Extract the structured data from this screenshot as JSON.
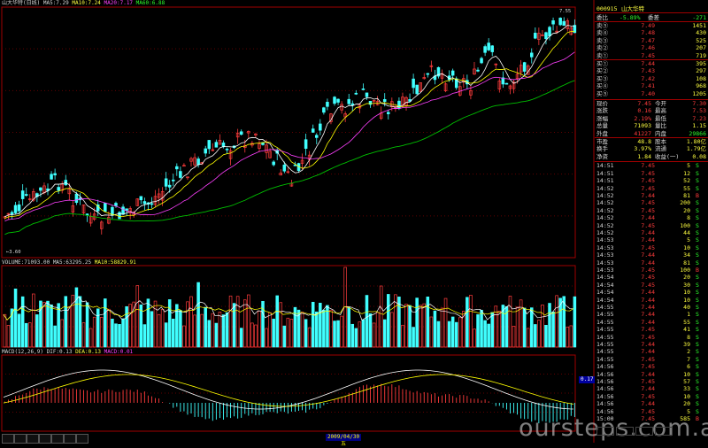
{
  "main_panel": {
    "title": "山大华特(日线)",
    "ma5": "MA5:7.29",
    "ma10": "MA10:7.24",
    "ma20": "MA20:7.17",
    "ma60": "MA60:6.88",
    "high_marker": "7.55",
    "low_marker": "←3.60"
  },
  "volume_panel": {
    "label": "VOLUME:71093.00",
    "ma5": "MA5:63295.25",
    "ma10": "MA10:58829.91"
  },
  "macd_panel": {
    "label": "MACD(12,26,9)",
    "dif": "DIF:0.13",
    "dea": "DEA:0.13",
    "macd": "MACD:0.01",
    "value_badge": "0.17"
  },
  "bottom": {
    "date_label": "2009/04/30五",
    "tabs": [
      "",
      "",
      "",
      "",
      "",
      "",
      ""
    ]
  },
  "right_header": {
    "code": "000915",
    "name": "山大华特"
  },
  "right_top": [
    {
      "label": "委比",
      "value": "-5.89%",
      "label2": "委差",
      "value2": "-271"
    },
    {
      "label": "卖⑤",
      "price": "7.49",
      "vol": "1451"
    },
    {
      "label": "卖④",
      "price": "7.48",
      "vol": "430"
    },
    {
      "label": "卖③",
      "price": "7.47",
      "vol": "525"
    },
    {
      "label": "卖②",
      "price": "7.46",
      "vol": "207"
    },
    {
      "label": "卖①",
      "price": "7.45",
      "vol": "719"
    },
    {
      "label": "买①",
      "price": "7.44",
      "vol": "395"
    },
    {
      "label": "买②",
      "price": "7.43",
      "vol": "297"
    },
    {
      "label": "买③",
      "price": "7.42",
      "vol": "108"
    },
    {
      "label": "买④",
      "price": "7.41",
      "vol": "968"
    },
    {
      "label": "买⑤",
      "price": "7.40",
      "vol": "1205"
    }
  ],
  "right_stats": [
    {
      "l1": "现价",
      "v1": "7.45",
      "l2": "今开",
      "v2": "7.30"
    },
    {
      "l1": "涨跌",
      "v1": "0.16",
      "l2": "最高",
      "v2": "7.53"
    },
    {
      "l1": "涨幅",
      "v1": "2.19%",
      "l2": "最低",
      "v2": "7.23"
    },
    {
      "l1": "总量",
      "v1": "71093",
      "l2": "量比",
      "v2": "1.15"
    },
    {
      "l1": "外盘",
      "v1": "41227",
      "l2": "内盘",
      "v2": "29866"
    },
    {
      "l1": "市盈",
      "v1": "48.8",
      "l2": "股本",
      "v2": "1.80亿"
    },
    {
      "l1": "换手",
      "v1": "3.97%",
      "l2": "流通",
      "v2": "1.79亿"
    },
    {
      "l1": "净资",
      "v1": "1.84",
      "l2": "收益(一)",
      "v2": "0.08"
    }
  ],
  "ticks": [
    {
      "t": "14:51",
      "p": "7.45",
      "v": "5",
      "s": "S"
    },
    {
      "t": "14:51",
      "p": "7.45",
      "v": "12",
      "s": "S"
    },
    {
      "t": "14:51",
      "p": "7.45",
      "v": "52",
      "s": "S"
    },
    {
      "t": "14:52",
      "p": "7.45",
      "v": "55",
      "s": "S"
    },
    {
      "t": "14:52",
      "p": "7.44",
      "v": "81",
      "s": "B"
    },
    {
      "t": "14:52",
      "p": "7.45",
      "v": "200",
      "s": "S"
    },
    {
      "t": "14:52",
      "p": "7.45",
      "v": "20",
      "s": "S"
    },
    {
      "t": "14:52",
      "p": "7.44",
      "v": "8",
      "s": "S"
    },
    {
      "t": "14:52",
      "p": "7.45",
      "v": "100",
      "s": "S"
    },
    {
      "t": "14:52",
      "p": "7.44",
      "v": "44",
      "s": "S"
    },
    {
      "t": "14:53",
      "p": "7.44",
      "v": "5",
      "s": "S"
    },
    {
      "t": "14:53",
      "p": "7.45",
      "v": "10",
      "s": "S"
    },
    {
      "t": "14:53",
      "p": "7.44",
      "v": "34",
      "s": "S"
    },
    {
      "t": "14:53",
      "p": "7.44",
      "v": "81",
      "s": "S"
    },
    {
      "t": "14:53",
      "p": "7.45",
      "v": "100",
      "s": "B"
    },
    {
      "t": "14:54",
      "p": "7.45",
      "v": "20",
      "s": "S"
    },
    {
      "t": "14:54",
      "p": "7.45",
      "v": "30",
      "s": "S"
    },
    {
      "t": "14:54",
      "p": "7.44",
      "v": "10",
      "s": "S"
    },
    {
      "t": "14:54",
      "p": "7.44",
      "v": "10",
      "s": "S"
    },
    {
      "t": "14:55",
      "p": "7.44",
      "v": "40",
      "s": "S"
    },
    {
      "t": "14:55",
      "p": "7.44",
      "v": "1",
      "s": "S"
    },
    {
      "t": "14:55",
      "p": "7.44",
      "v": "55",
      "s": "S"
    },
    {
      "t": "14:55",
      "p": "7.45",
      "v": "41",
      "s": "S"
    },
    {
      "t": "14:55",
      "p": "7.45",
      "v": "8",
      "s": "S"
    },
    {
      "t": "14:55",
      "p": "7.44",
      "v": "39",
      "s": "S"
    },
    {
      "t": "14:55",
      "p": "7.44",
      "v": "2",
      "s": "S"
    },
    {
      "t": "14:55",
      "p": "7.45",
      "v": "7",
      "s": "S"
    },
    {
      "t": "14:56",
      "p": "7.45",
      "v": "6",
      "s": "S"
    },
    {
      "t": "14:56",
      "p": "7.44",
      "v": "10",
      "s": "S"
    },
    {
      "t": "14:56",
      "p": "7.45",
      "v": "57",
      "s": "S"
    },
    {
      "t": "14:56",
      "p": "7.44",
      "v": "33",
      "s": "S"
    },
    {
      "t": "14:56",
      "p": "7.45",
      "v": "10",
      "s": "S"
    },
    {
      "t": "14:56",
      "p": "7.44",
      "v": "20",
      "s": "S"
    },
    {
      "t": "14:56",
      "p": "7.45",
      "v": "5",
      "s": "S"
    },
    {
      "t": "15:00",
      "p": "7.45",
      "v": "585",
      "s": "B"
    }
  ],
  "right_tabs": [
    "",
    "",
    "",
    ""
  ],
  "watermark": "oursteps.com.au",
  "colors": {
    "up": "#ff3c3c",
    "down": "#40ffff",
    "ma5": "#ffffff",
    "ma10": "#ffff00",
    "ma20": "#ff40ff",
    "ma60": "#00c000",
    "dif": "#ffffff",
    "dea": "#ffff00"
  }
}
